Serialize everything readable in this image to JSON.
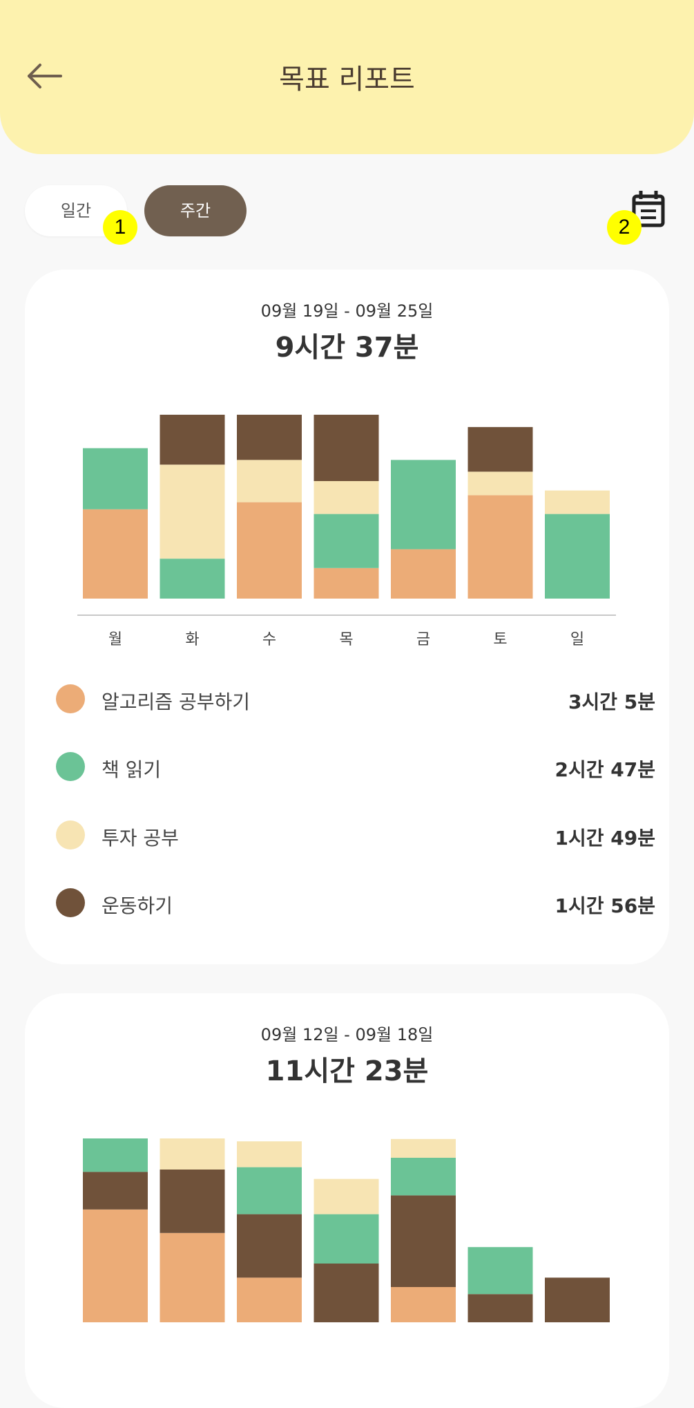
{
  "header": {
    "title": "목표 리포트"
  },
  "tabs": {
    "daily": "일간",
    "weekly": "주간",
    "active": "weekly"
  },
  "markers": [
    "1",
    "2"
  ],
  "colors": {
    "algorithm": "#ecac77",
    "book": "#6bc396",
    "invest": "#f7e4b3",
    "exercise": "#70523a",
    "header_bg": "#fdf2ae",
    "tab_active": "#716050"
  },
  "weeks": [
    {
      "range": "09월 19일 - 09월 25일",
      "total": "9시간 37분",
      "legend": [
        {
          "label": "알고리즘 공부하기",
          "value": "3시간 5분",
          "color": "#ecac77"
        },
        {
          "label": "책 읽기",
          "value": "2시간 47분",
          "color": "#6bc396"
        },
        {
          "label": "투자 공부",
          "value": "1시간 49분",
          "color": "#f7e4b3"
        },
        {
          "label": "운동하기",
          "value": "1시간 56분",
          "color": "#70523a"
        }
      ]
    },
    {
      "range": "09월 12일 - 09월 18일",
      "total": "11시간 23분"
    }
  ],
  "chart_data": [
    {
      "type": "bar",
      "stacked": true,
      "categories": [
        "월",
        "화",
        "수",
        "목",
        "금",
        "토",
        "일"
      ],
      "series": [
        {
          "name": "알고리즘 공부하기",
          "color": "#ecac77",
          "values": [
            38,
            0,
            41,
            13,
            21,
            44,
            0
          ]
        },
        {
          "name": "책 읽기",
          "color": "#6bc396",
          "values": [
            26,
            17,
            0,
            23,
            38,
            0,
            36
          ]
        },
        {
          "name": "투자 공부",
          "color": "#f7e4b3",
          "values": [
            0,
            40,
            18,
            14,
            0,
            10,
            10
          ]
        },
        {
          "name": "운동하기",
          "color": "#70523a",
          "values": [
            0,
            22,
            22,
            36,
            0,
            19,
            0
          ]
        }
      ]
    },
    {
      "type": "bar",
      "stacked": true,
      "categories": [
        "월",
        "화",
        "수",
        "목",
        "금",
        "토",
        "일"
      ],
      "series": [
        {
          "name": "알고리즘 공부하기",
          "color": "#ecac77",
          "values": [
            48,
            38,
            19,
            0,
            15,
            0,
            0
          ]
        },
        {
          "name": "운동하기",
          "color": "#70523a",
          "values": [
            16,
            27,
            27,
            25,
            39,
            12,
            19
          ]
        },
        {
          "name": "책 읽기",
          "color": "#6bc396",
          "values": [
            20,
            0,
            20,
            21,
            16,
            20,
            0
          ]
        },
        {
          "name": "투자 공부",
          "color": "#f7e4b3",
          "values": [
            0,
            16,
            11,
            15,
            8,
            0,
            0
          ]
        }
      ]
    }
  ]
}
